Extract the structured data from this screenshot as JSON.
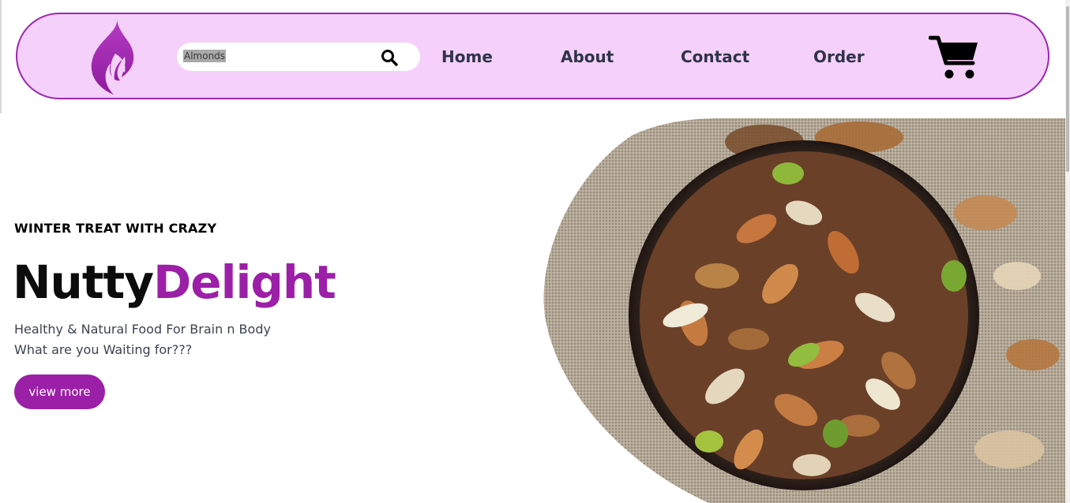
{
  "header": {
    "logo_icon": "flame-icon",
    "search": {
      "value": "Almonds",
      "icon": "search-icon"
    },
    "nav": [
      {
        "label": "Home"
      },
      {
        "label": "About"
      },
      {
        "label": "Contact"
      },
      {
        "label": "Order"
      }
    ],
    "cart_icon": "shopping-cart-icon"
  },
  "hero": {
    "tagline": "WINTER TREAT WITH CRAZY",
    "title_part1": "Nutty",
    "title_part2": "Delight",
    "subtitle_line1": "Healthy & Natural Food For Brain n Body",
    "subtitle_line2": "What are you Waiting for???",
    "button_label": "view more",
    "image_alt": "Bowl of mixed nuts"
  },
  "colors": {
    "accent": "#9c1fa8",
    "nav_background": "#f5d0fa",
    "nav_border": "#9c27b0",
    "nav_text": "#2f3447"
  }
}
